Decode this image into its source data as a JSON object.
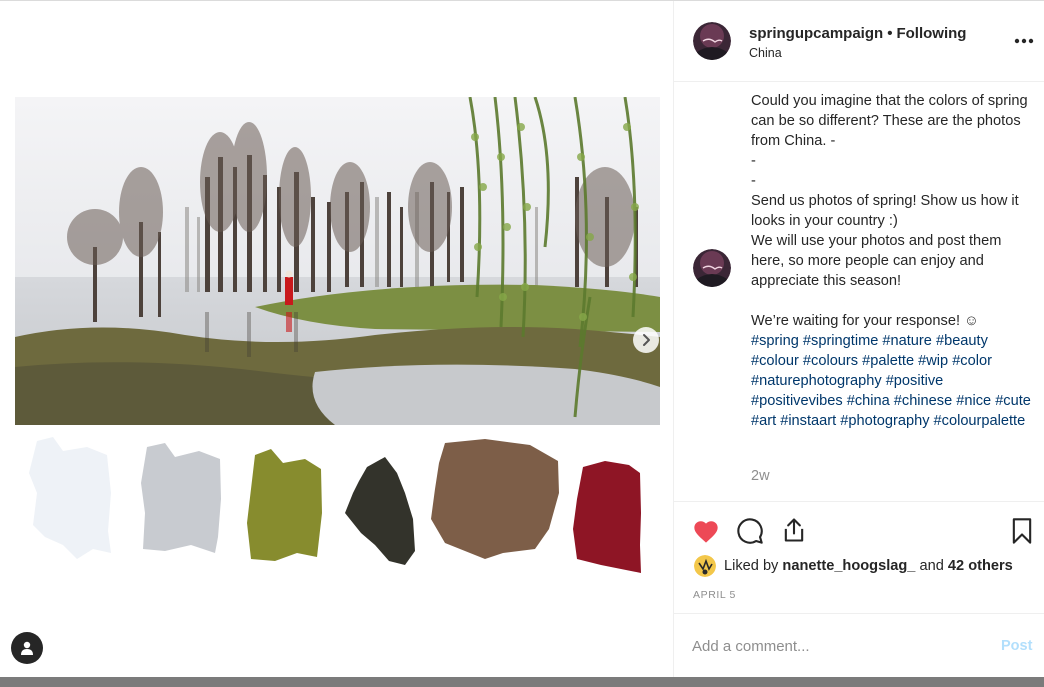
{
  "post": {
    "username": "springupcampaign",
    "separator": "•",
    "follow_status": "Following",
    "location": "China",
    "caption_lines": "Could you imagine that the colors of spring can be so different? These are the photos from China. -\n-\n-\nSend us photos of spring! Show us how it looks in your country :)\nWe will use your photos and post them here, so more people can enjoy and appreciate this season!\n\nWe’re waiting for your response! ☺",
    "hashtags": "#spring #springtime #nature #beauty #colour #colours #palette #wip #color #naturephotography #positive #positivevibes #china #chinese #nice #cute #art #instaart #photography #colourpalette",
    "time_ago": "2w",
    "liked_by_prefix": "Liked by",
    "liked_by_user": "nanette_hoogslag_",
    "liked_by_and": "and",
    "liked_by_others": "42 others",
    "date": "APRIL 5"
  },
  "comment": {
    "placeholder": "Add a comment...",
    "post_label": "Post"
  },
  "icons": {
    "more": "more-options-icon",
    "like": "heart-icon",
    "comment": "comment-bubble-icon",
    "share": "share-icon",
    "save": "bookmark-icon",
    "next": "chevron-right-icon",
    "profile": "profile-icon"
  },
  "palette": [
    "#eef2f7",
    "#c8cbd0",
    "#878c2e",
    "#33332b",
    "#7d5e48",
    "#8e1525"
  ],
  "colors": {
    "heart": "#ed4956",
    "link": "#00376b",
    "muted": "#8e8e8e",
    "post_disabled": "#b2dffc"
  }
}
